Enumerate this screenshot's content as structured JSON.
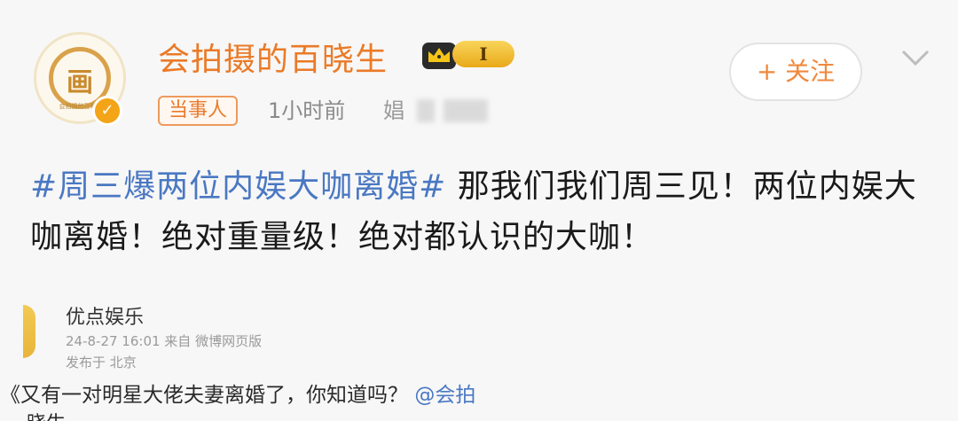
{
  "author": {
    "name": "会拍摄的百晓生",
    "avatar_glyph": "画",
    "avatar_caption": "会拍摄的百晓生",
    "verified_icon": "v-verified-icon",
    "level": "I",
    "crown_icon": "crown-icon"
  },
  "meta": {
    "tag": "当事人",
    "time": "1小时前",
    "source_visible": "娼"
  },
  "follow": {
    "label": "+ 关注",
    "chevron_icon": "chevron-down-icon"
  },
  "post": {
    "hashtag": "#周三爆两位内娱大咖离婚#",
    "text": "那我们我们周三见！两位内娱大咖离婚！绝对重量级！绝对都认识的大咖！"
  },
  "embedded": {
    "name": "优点娱乐",
    "meta": "24-8-27 16:01  来自 微博网页版",
    "location": "发布于 北京",
    "text_prefix": "《又有一对明星大佬夫妻离婚了，你知道吗？",
    "mention": "@会拍",
    "text_cut": "晓生"
  },
  "colors": {
    "username": "#eb7a27",
    "hashtag": "#4a78c2",
    "badge": "#f3a417"
  }
}
